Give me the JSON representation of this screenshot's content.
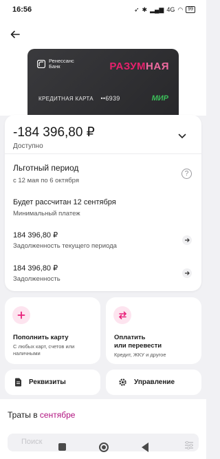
{
  "status_bar": {
    "time": "16:56",
    "signal": "4G",
    "battery": "99"
  },
  "card": {
    "bank_name": "Ренессанс Банк",
    "brand_part1": "РАЗУМ",
    "brand_part2": "НАЯ",
    "label": "КРЕДИТНАЯ КАРТА",
    "number_masked": "••6939",
    "payment_system": "МИР"
  },
  "balance": {
    "amount": "-184 396,80 ₽",
    "caption": "Доступно"
  },
  "grace": {
    "title": "Льготный период",
    "dates": "с 12 мая по 6 октября",
    "help": "?"
  },
  "min_payment": {
    "title": "Будет рассчитан 12 сентября",
    "caption": "Минимальный платеж"
  },
  "rows": [
    {
      "amount": "184 396,80 ₽",
      "caption": "Задолженность текущего периода"
    },
    {
      "amount": "184 396,80 ₽",
      "caption": "Задолженность"
    }
  ],
  "tiles": {
    "topup": {
      "title": "Пополнить карту",
      "subtitle_line1": "С любых карт, счетов или",
      "subtitle_line2": "наличными",
      "icon_color": "#e8207a"
    },
    "pay": {
      "title_line1": "Оплатить",
      "title_line2": "или перевести",
      "subtitle": "Кредит, ЖКУ и другое",
      "icon_color": "#e8207a"
    }
  },
  "buttons": {
    "details": "Реквизиты",
    "manage": "Управление"
  },
  "spending": {
    "prefix": "Траты в ",
    "month": "сентябре",
    "search_placeholder": "Поиск"
  },
  "colors": {
    "accent": "#e6206c",
    "accent_dark": "#b0127f"
  }
}
